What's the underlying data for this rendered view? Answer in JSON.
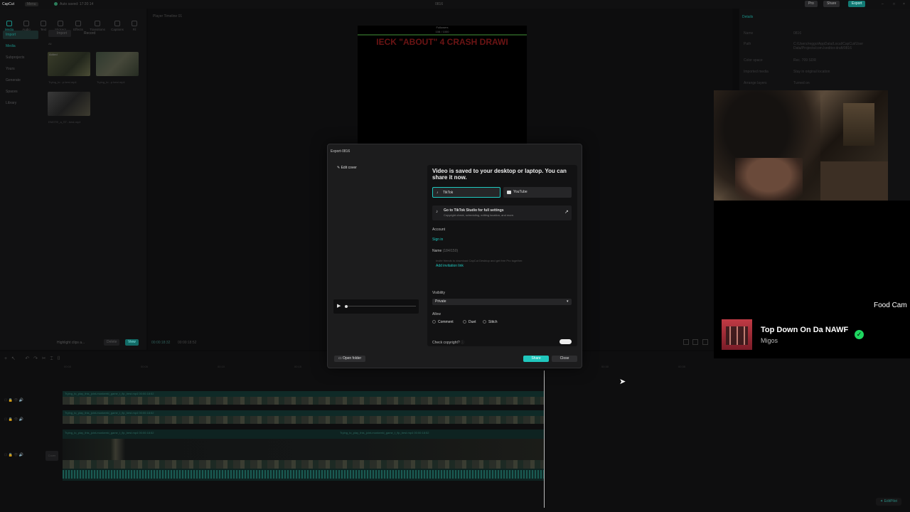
{
  "topbar": {
    "app_name": "CapCut",
    "menu": "Menu",
    "autosave": "Auto saved: 17:20:14",
    "project": "0816",
    "pro": "Pro",
    "share": "Share",
    "export": "Export"
  },
  "toolbar": {
    "items": [
      "Media",
      "Audio",
      "Text",
      "Stickers",
      "Effects",
      "Transitions",
      "Captions",
      "Fil"
    ]
  },
  "sidebar": {
    "items": [
      "Import",
      "Media",
      "Subprojects",
      "Yours",
      "Generate",
      "Spaces",
      "Library"
    ]
  },
  "media": {
    "import": "Import",
    "record": "Record",
    "all": "All",
    "added": "Added",
    "thumbs": [
      "Trying_to...p.best.mp4",
      "Trying_to...p.best.mp4",
      "EMOTE_a_ST...best.mp4"
    ]
  },
  "player": {
    "title": "Player  Timeline 01",
    "followers": "Followers",
    "follower_count": "108 / 1000",
    "banner": "IECK \"ABOUT\" 4 CRASH DRAWI",
    "timecode": "00:00:18:32",
    "duration": "00:00:18:52"
  },
  "details": {
    "header": "Details",
    "rows": [
      {
        "k": "Name",
        "v": "0816"
      },
      {
        "k": "Path",
        "v": "C:/Users/reggo/AppData/Local/CapCut/User Data/Projects/com.lveditor.draft/0816"
      },
      {
        "k": "Color space",
        "v": "Rec. 709 SDR"
      },
      {
        "k": "Imported media",
        "v": "Stay in original location"
      },
      {
        "k": "Arrange layers",
        "v": "Turned on"
      }
    ]
  },
  "highlight": {
    "label": "Highlight clips a...",
    "delete": "Delete",
    "view": "View"
  },
  "modal": {
    "title": "Export-0816",
    "edit_cover": "Edit cover",
    "heading": "Video is saved to your desktop or laptop. You can share it now.",
    "tiktok": "TikTok",
    "youtube": "YouTube",
    "studio_title": "Go to TikTok Studio for full settings",
    "studio_sub": "Copyright check, scheduling, editing location, and more.",
    "account": "Account",
    "sign_in": "Sign in",
    "name_label": "Name",
    "name_count": "(184/150)",
    "name_placeholder": "Invite friends to download CapCut Desktop and get free Pro together.",
    "add_link": "Add invitation link",
    "visibility": "Visibility",
    "visibility_value": "Private",
    "allow": "Allow",
    "comment": "Comment",
    "duet": "Duet",
    "stitch": "Stitch",
    "copyright": "Check copyright?",
    "open_folder": "Open folder",
    "share": "Share",
    "close": "Close"
  },
  "timeline": {
    "clip1": "Trying_to_play_this_joint-monkeeki_game_t_flp_best.mp4  00:00:18:52",
    "clip2": "Trying_to_play_this_joint-monkeeki_game_t_flp_best.mp4  00:00:18:52",
    "clip3a": "Trying_to_play_this_joint-monkeeki_game_t_flp_best.mp4  00:00:18:52",
    "clip3b": "Trying_to_play_this_joint-monkeeki_game_t_flp_best.mp4  00:00:18:52",
    "cover": "Cover",
    "ticks": [
      "00:00",
      "00:05",
      "00:10",
      "00:15",
      "00:20",
      "00:25",
      "00:30",
      "00:35"
    ]
  },
  "overlay": {
    "food_cam": "Food Cam",
    "song": "Top Down On Da NAWF",
    "artist": "Migos"
  },
  "footer": {
    "editpilot": "EditPilot"
  },
  "colors": {
    "accent": "#1fc9c0",
    "share_btn": "#20c7bd",
    "spotify_green": "#1ed760"
  }
}
